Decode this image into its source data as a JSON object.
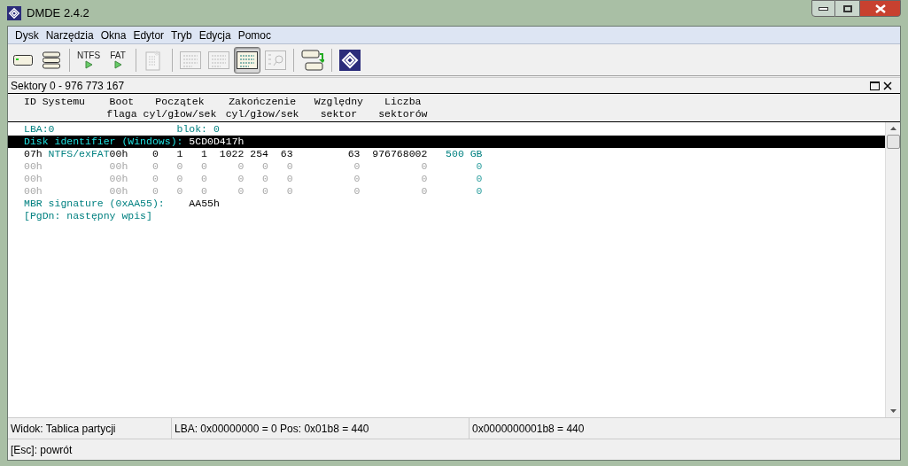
{
  "window": {
    "title": "DMDE 2.4.2"
  },
  "menu": [
    {
      "label": "Dysk"
    },
    {
      "label": "Narzędzia"
    },
    {
      "label": "Okna"
    },
    {
      "label": "Edytor"
    },
    {
      "label": "Tryb"
    },
    {
      "label": "Edycja"
    },
    {
      "label": "Pomoc"
    }
  ],
  "toolbar": [
    {
      "disabled": false,
      "selected": false
    },
    {
      "disabled": false,
      "selected": false
    },
    {
      "label": "NTFS",
      "disabled": false,
      "selected": false
    },
    {
      "label": "FAT",
      "disabled": false,
      "selected": false
    },
    {
      "disabled": true,
      "selected": false
    },
    {
      "disabled": true,
      "selected": false
    },
    {
      "disabled": true,
      "selected": false
    },
    {
      "disabled": false,
      "selected": true
    },
    {
      "disabled": true,
      "selected": false
    },
    {
      "disabled": false,
      "selected": false
    },
    {
      "disabled": false,
      "selected": false
    }
  ],
  "panel": {
    "title": "Sektory 0 - 976 773 167",
    "headings": [
      {
        "lines": [
          "ID Systemu"
        ]
      },
      {
        "lines": [
          "Boot",
          "flaga"
        ]
      },
      {
        "lines": [
          "Początek",
          "cyl/głow/sek"
        ]
      },
      {
        "lines": [
          "Zakończenie",
          "cyl/głow/sek"
        ]
      },
      {
        "lines": [
          "Względny",
          "sektor"
        ]
      },
      {
        "lines": [
          "Liczba",
          "sektorów"
        ]
      }
    ],
    "lba_line": [
      "LBA:0",
      "blok: 0"
    ],
    "disk_identifier": {
      "label": "Disk identifier (Windows):",
      "value": "5CD0D417h",
      "selected": true
    },
    "rows": [
      {
        "used": true,
        "cells": [
          "07h",
          "NTFS/exFAT",
          "00h",
          "0",
          "1",
          "1",
          "1022",
          "254",
          "63",
          "63",
          "976768002",
          "500 GB"
        ]
      },
      {
        "used": false,
        "cells": [
          "00h",
          "",
          "00h",
          "0",
          "0",
          "0",
          "0",
          "0",
          "0",
          "0",
          "0",
          "0"
        ]
      },
      {
        "used": false,
        "cells": [
          "00h",
          "",
          "00h",
          "0",
          "0",
          "0",
          "0",
          "0",
          "0",
          "0",
          "0",
          "0"
        ]
      },
      {
        "used": false,
        "cells": [
          "00h",
          "",
          "00h",
          "0",
          "0",
          "0",
          "0",
          "0",
          "0",
          "0",
          "0",
          "0"
        ]
      }
    ],
    "signature": {
      "label": "MBR signature (0xAA55):",
      "value": "AA55h"
    },
    "hint": "[PgDn: następny wpis]"
  },
  "status_bar": [
    "Widok: Tablica partycji",
    "LBA: 0x00000000 = 0  Pos: 0x01b8 = 440",
    "0x0000000001b8 = 440"
  ],
  "help_line": "[Esc]: powrót"
}
